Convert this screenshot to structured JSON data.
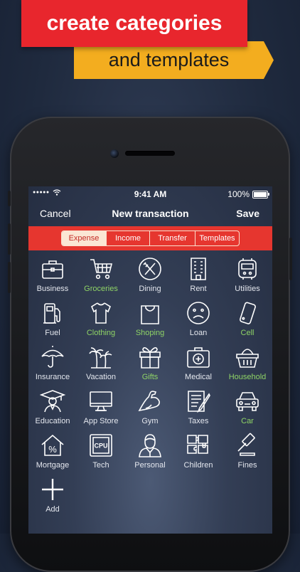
{
  "banner": {
    "line1": "create categories",
    "line2": "and templates"
  },
  "status_bar": {
    "signal": "●●●●●",
    "time": "9:41 AM",
    "battery_text": "100%"
  },
  "nav": {
    "cancel": "Cancel",
    "title": "New transaction",
    "save": "Save"
  },
  "segments": [
    {
      "label": "Expense",
      "active": true
    },
    {
      "label": "Income",
      "active": false
    },
    {
      "label": "Transfer",
      "active": false
    },
    {
      "label": "Templates",
      "active": false
    }
  ],
  "categories": [
    {
      "label": "Business",
      "icon": "briefcase-icon",
      "highlight": false
    },
    {
      "label": "Groceries",
      "icon": "shopping-cart-icon",
      "highlight": true
    },
    {
      "label": "Dining",
      "icon": "fork-knife-icon",
      "highlight": false
    },
    {
      "label": "Rent",
      "icon": "building-icon",
      "highlight": false
    },
    {
      "label": "Utilities",
      "icon": "meter-icon",
      "highlight": false
    },
    {
      "label": "Fuel",
      "icon": "fuel-pump-icon",
      "highlight": false
    },
    {
      "label": "Clothing",
      "icon": "shirt-icon",
      "highlight": true
    },
    {
      "label": "Shoping",
      "icon": "shopping-bag-icon",
      "highlight": true
    },
    {
      "label": "Loan",
      "icon": "sad-face-icon",
      "highlight": false
    },
    {
      "label": "Cell",
      "icon": "mobile-phone-icon",
      "highlight": true
    },
    {
      "label": "Insurance",
      "icon": "umbrella-icon",
      "highlight": false
    },
    {
      "label": "Vacation",
      "icon": "palm-trees-icon",
      "highlight": false
    },
    {
      "label": "Gifts",
      "icon": "gift-icon",
      "highlight": true
    },
    {
      "label": "Medical",
      "icon": "medical-kit-icon",
      "highlight": false
    },
    {
      "label": "Household",
      "icon": "basket-icon",
      "highlight": true
    },
    {
      "label": "Education",
      "icon": "graduate-icon",
      "highlight": false
    },
    {
      "label": "App Store",
      "icon": "monitor-icon",
      "highlight": false
    },
    {
      "label": "Gym",
      "icon": "flexed-arm-icon",
      "highlight": false
    },
    {
      "label": "Taxes",
      "icon": "tax-form-icon",
      "highlight": false
    },
    {
      "label": "Car",
      "icon": "car-icon",
      "highlight": true
    },
    {
      "label": "Mortgage",
      "icon": "house-percent-icon",
      "highlight": false
    },
    {
      "label": "Tech",
      "icon": "cpu-chip-icon",
      "highlight": false
    },
    {
      "label": "Personal",
      "icon": "person-icon",
      "highlight": false
    },
    {
      "label": "Children",
      "icon": "puzzle-icon",
      "highlight": false
    },
    {
      "label": "Fines",
      "icon": "gavel-icon",
      "highlight": false
    },
    {
      "label": "Add",
      "icon": "plus-icon",
      "highlight": false
    }
  ],
  "icon_glyphs": {
    "cpu_chip": "CPU",
    "house_percent": "%"
  },
  "colors": {
    "banner_red": "#e8262d",
    "banner_orange": "#f3ad1f",
    "segment_bar_red": "#e6362f",
    "highlight_green": "#8fd466"
  }
}
